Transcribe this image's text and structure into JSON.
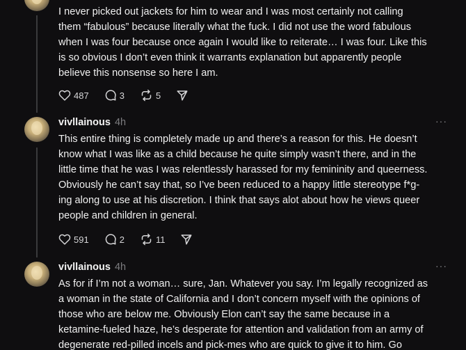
{
  "posts": [
    {
      "username": "",
      "time": "",
      "lines": [
        "I never picked out jackets for him to wear and I was most certainly not calling",
        "them “fabulous” because literally what the fuck. I did not use the word fabulous",
        "when I was four because once again I would like to reiterate… I was four. Like this",
        "is so obvious I don’t even think it warrants explanation but apparently people",
        "believe this nonsense so here I am."
      ],
      "likes": "487",
      "replies": "3",
      "reposts": "5"
    },
    {
      "username": "vivllainous",
      "time": "4h",
      "lines": [
        "This entire thing is completely made up and there’s a reason for this. He doesn’t",
        "know what I was like as a child because he quite simply wasn’t there, and in the",
        "little time that he was I was relentlessly harassed for my femininity and queerness.",
        "Obviously he can’t say that, so I’ve been reduced to a happy little stereotype f*g-",
        "ing along to use at his discretion. I think that says alot about how he views queer",
        "people and children in general."
      ],
      "likes": "591",
      "replies": "2",
      "reposts": "11"
    },
    {
      "username": "vivllainous",
      "time": "4h",
      "lines": [
        "As for if I’m not a woman… sure, Jan. Whatever you say. I’m legally recognized as",
        "a woman in the state of California and I don’t concern myself with the opinions of",
        "those who are below me. Obviously Elon can’t say the same because in a",
        "ketamine-fueled haze, he’s desperate for attention and validation from an army of",
        "degenerate red-pilled incels and pick-mes who are quick to give it to him. Go"
      ]
    }
  ],
  "icons": {
    "like": "heart-icon",
    "reply": "comment-icon",
    "repost": "repost-icon",
    "share": "send-icon",
    "more": "more-icon"
  },
  "more_label": "···"
}
